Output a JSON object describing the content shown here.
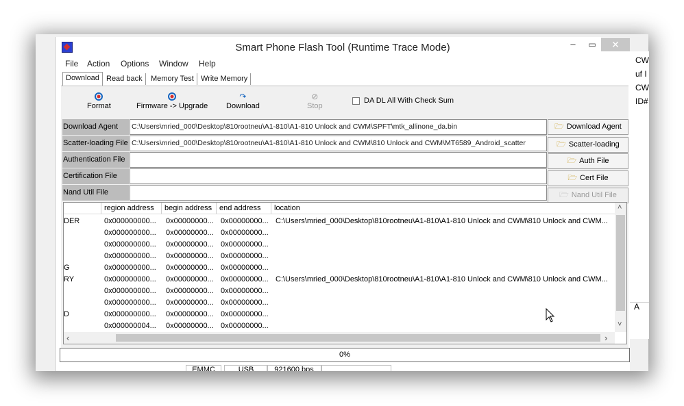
{
  "window": {
    "title": "Smart Phone Flash Tool (Runtime Trace Mode)"
  },
  "menu": [
    "File",
    "Action",
    "Options",
    "Window",
    "Help"
  ],
  "tabs": [
    "Download",
    "Read back",
    "Memory Test",
    "Write Memory"
  ],
  "toolbar": {
    "format": "Format",
    "upgrade": "Firmware -> Upgrade",
    "download": "Download",
    "stop": "Stop",
    "checksum": "DA DL All With Check Sum"
  },
  "fields": [
    {
      "label": "Download Agent",
      "value": "C:\\Users\\mried_000\\Desktop\\810rootneu\\A1-810\\A1-810 Unlock and CWM\\SPFT\\mtk_allinone_da.bin",
      "button": "Download Agent"
    },
    {
      "label": "Scatter-loading File",
      "value": "C:\\Users\\mried_000\\Desktop\\810rootneu\\A1-810\\A1-810 Unlock and CWM\\810 Unlock and CWM\\MT6589_Android_scatter",
      "button": "Scatter-loading"
    },
    {
      "label": "Authentication File",
      "value": "",
      "button": "Auth File"
    },
    {
      "label": "Certification File",
      "value": "",
      "button": "Cert File"
    },
    {
      "label": "Nand Util File",
      "value": "",
      "button": "Nand Util File"
    }
  ],
  "table": {
    "headers": [
      "region address",
      "begin address",
      "end address",
      "location"
    ],
    "rows": [
      {
        "name": "DER",
        "region": "0x000000000...",
        "begin": "0x00000000...",
        "end": "0x00000000...",
        "location": "C:\\Users\\mried_000\\Desktop\\810rootneu\\A1-810\\A1-810 Unlock and CWM\\810 Unlock and CWM..."
      },
      {
        "name": "",
        "region": "0x000000000...",
        "begin": "0x00000000...",
        "end": "0x00000000...",
        "location": ""
      },
      {
        "name": "",
        "region": "0x000000000...",
        "begin": "0x00000000...",
        "end": "0x00000000...",
        "location": ""
      },
      {
        "name": "",
        "region": "0x000000000...",
        "begin": "0x00000000...",
        "end": "0x00000000...",
        "location": ""
      },
      {
        "name": "G",
        "region": "0x000000000...",
        "begin": "0x00000000...",
        "end": "0x00000000...",
        "location": ""
      },
      {
        "name": "RY",
        "region": "0x000000000...",
        "begin": "0x00000000...",
        "end": "0x00000000...",
        "location": "C:\\Users\\mried_000\\Desktop\\810rootneu\\A1-810\\A1-810 Unlock and CWM\\810 Unlock and CWM..."
      },
      {
        "name": "",
        "region": "0x000000000...",
        "begin": "0x00000000...",
        "end": "0x00000000...",
        "location": ""
      },
      {
        "name": "",
        "region": "0x000000000...",
        "begin": "0x00000000...",
        "end": "0x00000000...",
        "location": ""
      },
      {
        "name": "D",
        "region": "0x000000000...",
        "begin": "0x00000000...",
        "end": "0x00000000...",
        "location": ""
      },
      {
        "name": "",
        "region": "0x000000004...",
        "begin": "0x00000000...",
        "end": "0x00000000...",
        "location": ""
      }
    ]
  },
  "progress": {
    "text": "0%",
    "value": 0
  },
  "statusbar": [
    "EMMC",
    "USB",
    "921600 bps"
  ],
  "background_window": {
    "lines": [
      "CWI",
      "uf I",
      "CWI",
      "ID#"
    ],
    "bottom": "A"
  }
}
